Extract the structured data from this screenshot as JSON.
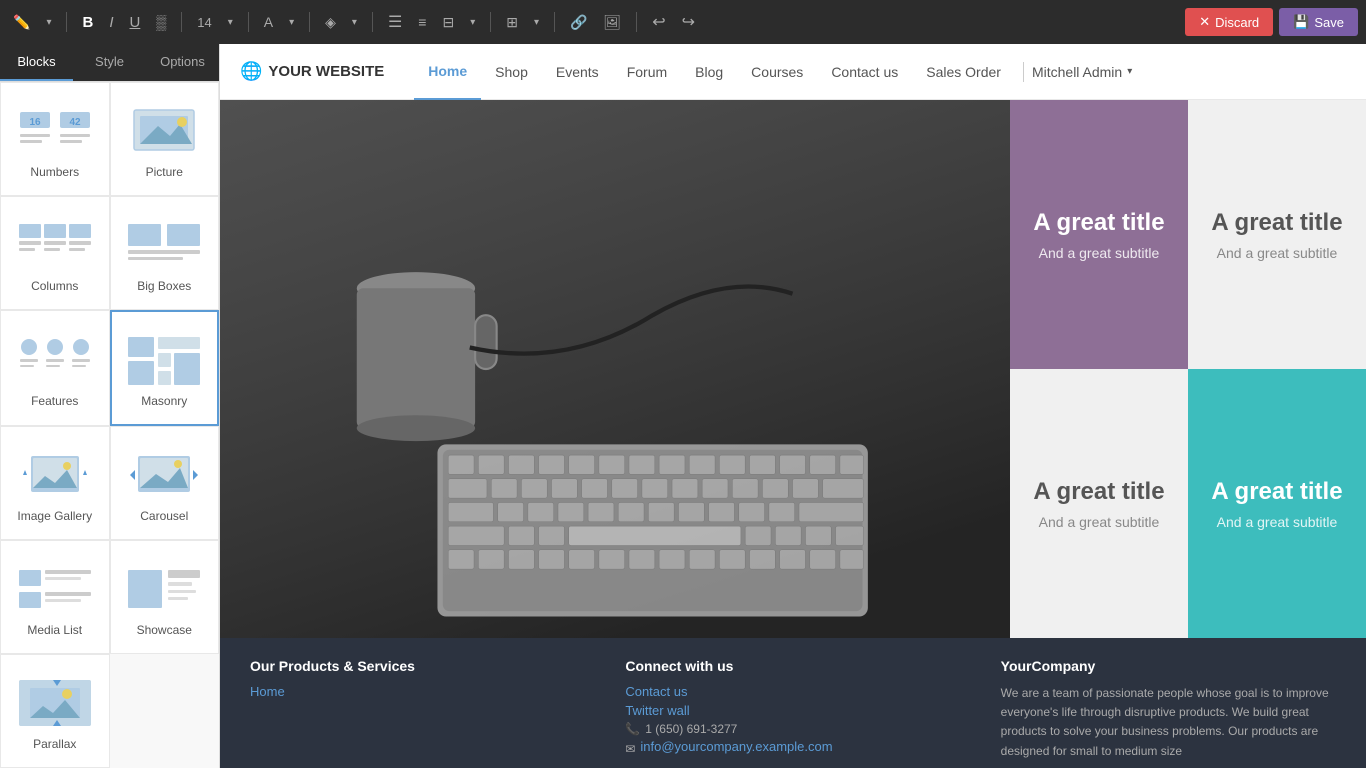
{
  "toolbar": {
    "font_size": "14",
    "discard_label": "Discard",
    "save_label": "Save",
    "tools": [
      "pencil",
      "bold",
      "italic",
      "underline",
      "highlight",
      "font-size",
      "font-family",
      "color",
      "list-ul",
      "list-ol",
      "align",
      "table",
      "link",
      "image",
      "undo",
      "redo"
    ]
  },
  "sidebar": {
    "tabs": [
      "Blocks",
      "Style",
      "Options"
    ],
    "active_tab": "Blocks",
    "items": [
      {
        "id": "numbers",
        "label": "Numbers"
      },
      {
        "id": "picture",
        "label": "Picture"
      },
      {
        "id": "columns",
        "label": "Columns"
      },
      {
        "id": "big-boxes",
        "label": "Big Boxes"
      },
      {
        "id": "features",
        "label": "Features"
      },
      {
        "id": "masonry",
        "label": "Masonry",
        "active": true
      },
      {
        "id": "image-gallery",
        "label": "Image Gallery"
      },
      {
        "id": "carousel",
        "label": "Carousel"
      },
      {
        "id": "media-list",
        "label": "Media List"
      },
      {
        "id": "showcase",
        "label": "Showcase"
      },
      {
        "id": "parallax",
        "label": "Parallax"
      }
    ]
  },
  "navbar": {
    "brand": "YOUR WEBSITE",
    "links": [
      "Home",
      "Shop",
      "Events",
      "Forum",
      "Blog",
      "Courses",
      "Contact us",
      "Sales Order"
    ],
    "active_link": "Home",
    "user": "Mitchell Admin"
  },
  "hero": {
    "cells": [
      {
        "title": "A great title",
        "subtitle": "And a great subtitle",
        "theme": "purple"
      },
      {
        "title": "A great title",
        "subtitle": "And a great subtitle",
        "theme": "light"
      },
      {
        "title": "A great title",
        "subtitle": "And a great subtitle",
        "theme": "light"
      },
      {
        "title": "A great title",
        "subtitle": "And a great subtitle",
        "theme": "teal"
      }
    ]
  },
  "footer": {
    "cols": [
      {
        "title": "Our Products & Services",
        "links": [
          "Home"
        ]
      },
      {
        "title": "Connect with us",
        "links": [
          "Contact us",
          "Twitter wall"
        ],
        "phone": "1 (650) 691-3277",
        "email": "info@yourcompany.example.com"
      },
      {
        "title": "YourCompany",
        "text": "We are a team of passionate people whose goal is to improve everyone's life through disruptive products. We build great products to solve your business problems.\n\nOur products are designed for small to medium size"
      }
    ]
  }
}
